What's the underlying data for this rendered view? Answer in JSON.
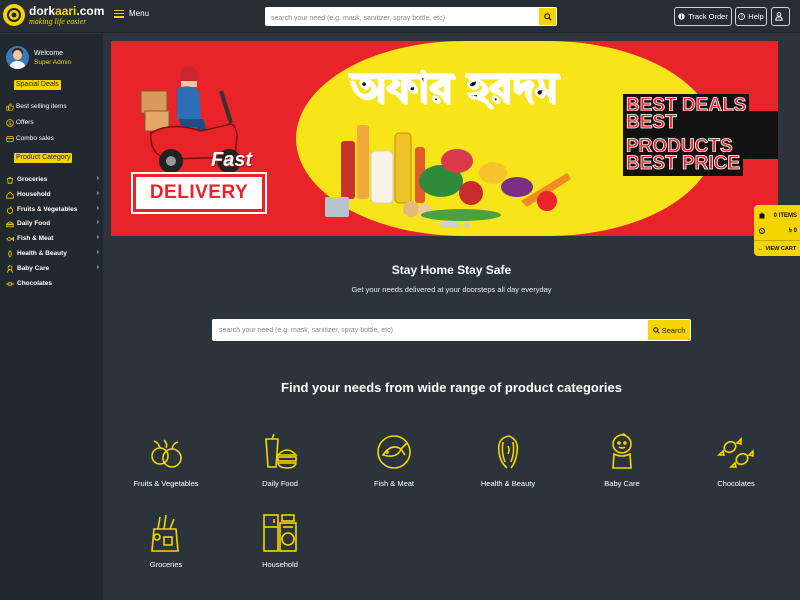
{
  "brand": {
    "name_part1": "dork",
    "name_part2": "aari",
    "name_part3": ".com",
    "tagline": "making life easier"
  },
  "header": {
    "menu_label": "Menu",
    "search_placeholder": "search your need (e.g. mask, sanitizer, spray bottle, etc)",
    "track_order_label": "Track Order",
    "help_label": "Help"
  },
  "sidebar": {
    "welcome": "Welcome",
    "user_role": "Super Admin",
    "special_deals_label": "Spacial Deals",
    "special_links": [
      {
        "label": "Best selling items",
        "icon": "thumbs-up-icon"
      },
      {
        "label": "Offers",
        "icon": "offer-icon"
      },
      {
        "label": "Combo sales",
        "icon": "combo-icon"
      }
    ],
    "category_label": "Product Category",
    "categories": [
      {
        "label": "Groceries",
        "has_children": true
      },
      {
        "label": "Household",
        "has_children": true
      },
      {
        "label": "Fruits & Vegetables",
        "has_children": true
      },
      {
        "label": "Daily Food",
        "has_children": true
      },
      {
        "label": "Fish & Meat",
        "has_children": true
      },
      {
        "label": "Health & Beauty",
        "has_children": true
      },
      {
        "label": "Baby Care",
        "has_children": true
      },
      {
        "label": "Chocolates",
        "has_children": false
      }
    ]
  },
  "banner": {
    "title": "অফার হরদম",
    "fast": "Fast",
    "delivery": "DELIVERY",
    "deals": [
      "BEST DEALS",
      "BEST PRODUCTS",
      "BEST PRICE"
    ]
  },
  "cart": {
    "items": "0 ITEMS",
    "currency": "৳",
    "amount": "0",
    "view_cart": "VIEW CART"
  },
  "hero": {
    "title": "Stay Home Stay Safe",
    "subtitle": "Get your needs delivered at your doorsteps all day everyday",
    "search_placeholder": "search your need (e.g. mask, sanitizer, spray bottle, etc)",
    "search_button": "Search"
  },
  "categories_section": {
    "title": "Find your needs from wide range of product categories",
    "tiles": [
      {
        "label": "Fruits & Vegetables",
        "icon": "fruits-icon"
      },
      {
        "label": "Daily Food",
        "icon": "fast-food-icon"
      },
      {
        "label": "Fish & Meat",
        "icon": "fish-icon"
      },
      {
        "label": "Health & Beauty",
        "icon": "beauty-icon"
      },
      {
        "label": "Baby Care",
        "icon": "baby-icon"
      },
      {
        "label": "Chocolates",
        "icon": "candy-icon"
      },
      {
        "label": "Groceries",
        "icon": "grocery-bag-icon"
      },
      {
        "label": "Household",
        "icon": "appliance-icon"
      }
    ]
  },
  "colors": {
    "accent": "#f5d400",
    "background": "#2c343b",
    "sidebar": "#21282e",
    "banner_red": "#e8232a"
  }
}
